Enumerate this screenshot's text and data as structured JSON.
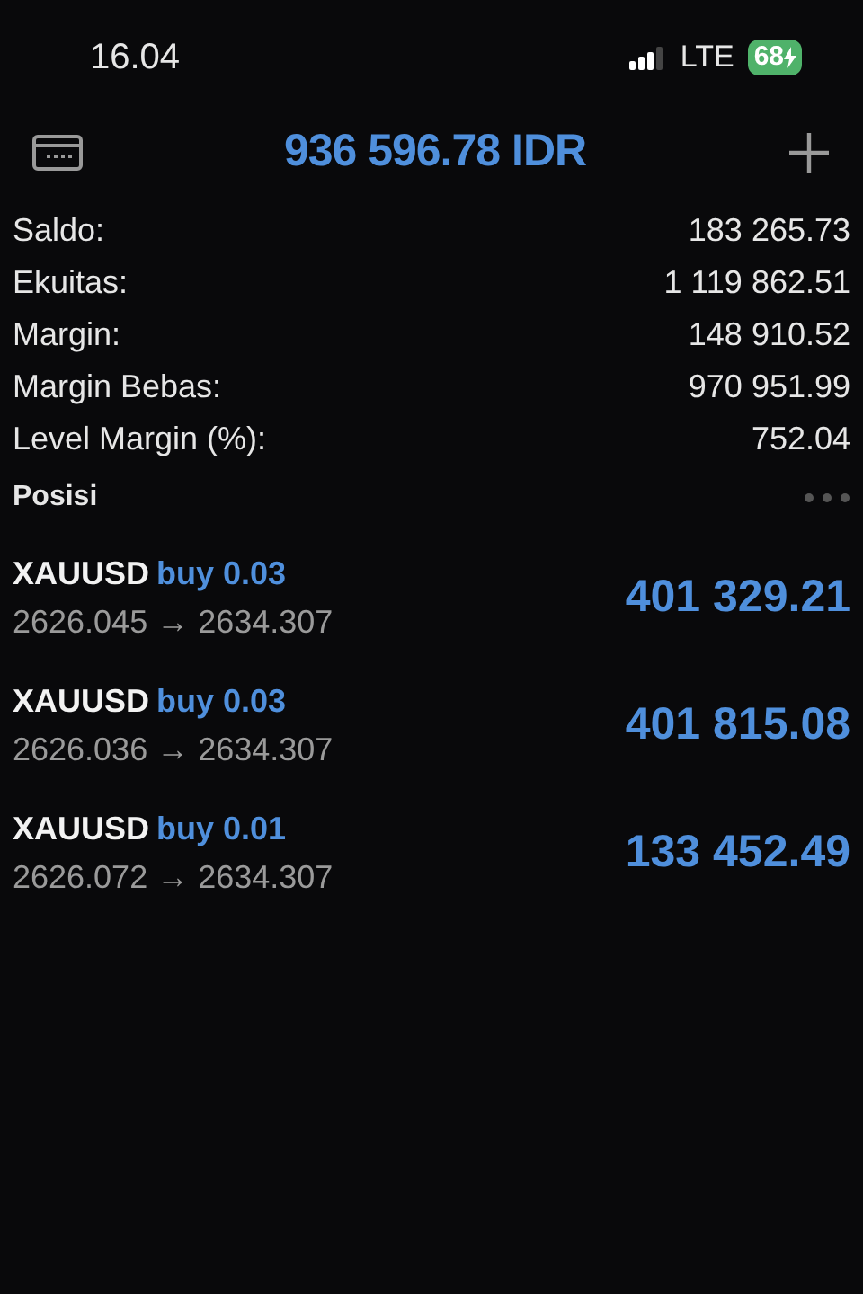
{
  "status_bar": {
    "time": "16.04",
    "network": "LTE",
    "battery": "68",
    "charging": true
  },
  "header": {
    "balance": "936 596.78 IDR"
  },
  "account": [
    {
      "label": "Saldo:",
      "value": "183 265.73"
    },
    {
      "label": "Ekuitas:",
      "value": "1 119 862.51"
    },
    {
      "label": "Margin:",
      "value": "148 910.52"
    },
    {
      "label": "Margin Bebas:",
      "value": "970 951.99"
    },
    {
      "label": "Level Margin (%):",
      "value": "752.04"
    }
  ],
  "positions_title": "Posisi",
  "positions": [
    {
      "symbol": "XAUUSD",
      "side": "buy 0.03",
      "prices": "2626.045 → 2634.307",
      "profit": "401 329.21"
    },
    {
      "symbol": "XAUUSD",
      "side": "buy 0.03",
      "prices": "2626.036 → 2634.307",
      "profit": "401 815.08"
    },
    {
      "symbol": "XAUUSD",
      "side": "buy 0.01",
      "prices": "2626.072 → 2634.307",
      "profit": "133 452.49"
    }
  ]
}
